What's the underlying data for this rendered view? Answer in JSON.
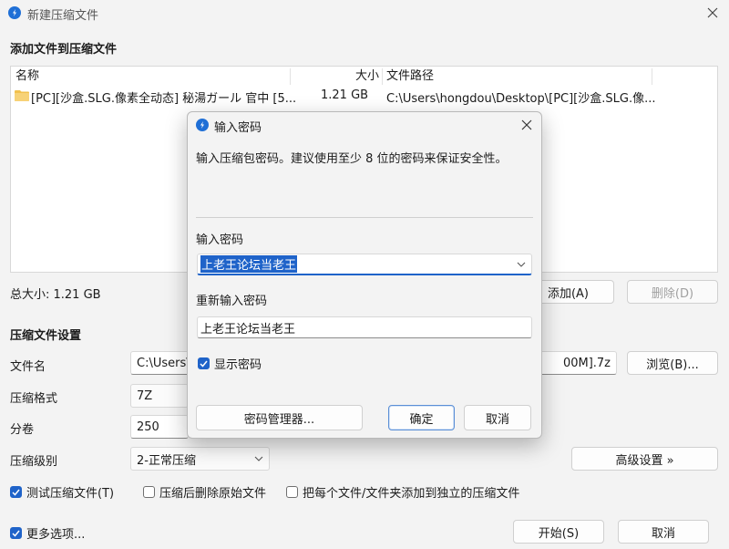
{
  "window": {
    "title": "新建压缩文件"
  },
  "add_section": {
    "title": "添加文件到压缩文件"
  },
  "file_list": {
    "columns": [
      "名称",
      "大小",
      "文件路径"
    ],
    "rows": [
      {
        "name": "[PC][沙盒.SLG.像素全动态] 秘湯ガール 官中 [5...",
        "size": "1.21 GB",
        "path": "C:\\Users\\hongdou\\Desktop\\[PC][沙盒.SLG.像..."
      }
    ]
  },
  "total_size": "总大小: 1.21 GB",
  "buttons": {
    "add": "添加(A)",
    "delete": "删除(D)",
    "browse": "浏览(B)...",
    "advanced": "高级设置 »",
    "start": "开始(S)",
    "cancel": "取消"
  },
  "settings": {
    "title": "压缩文件设置",
    "filename_label": "文件名",
    "filename_value_left": "C:\\Users\\",
    "filename_value_right": "00M].7z",
    "format_label": "压缩格式",
    "format_value": "7Z",
    "volume_label": "分卷",
    "volume_value": "250",
    "level_label": "压缩级别",
    "level_value": "2-正常压缩"
  },
  "options": {
    "test": "测试压缩文件(T)",
    "delete_after": "压缩后删除原始文件",
    "separate": "把每个文件/文件夹添加到独立的压缩文件",
    "more": "更多选项..."
  },
  "password_dialog": {
    "title": "输入密码",
    "message": "输入压缩包密码。建议使用至少 8 位的密码来保证安全性。",
    "password_label": "输入密码",
    "password_value": "上老王论坛当老王",
    "confirm_label": "重新输入密码",
    "confirm_value": "上老王论坛当老王",
    "show_password": "显示密码",
    "manager_button": "密码管理器...",
    "ok_button": "确定",
    "cancel_button": "取消"
  }
}
